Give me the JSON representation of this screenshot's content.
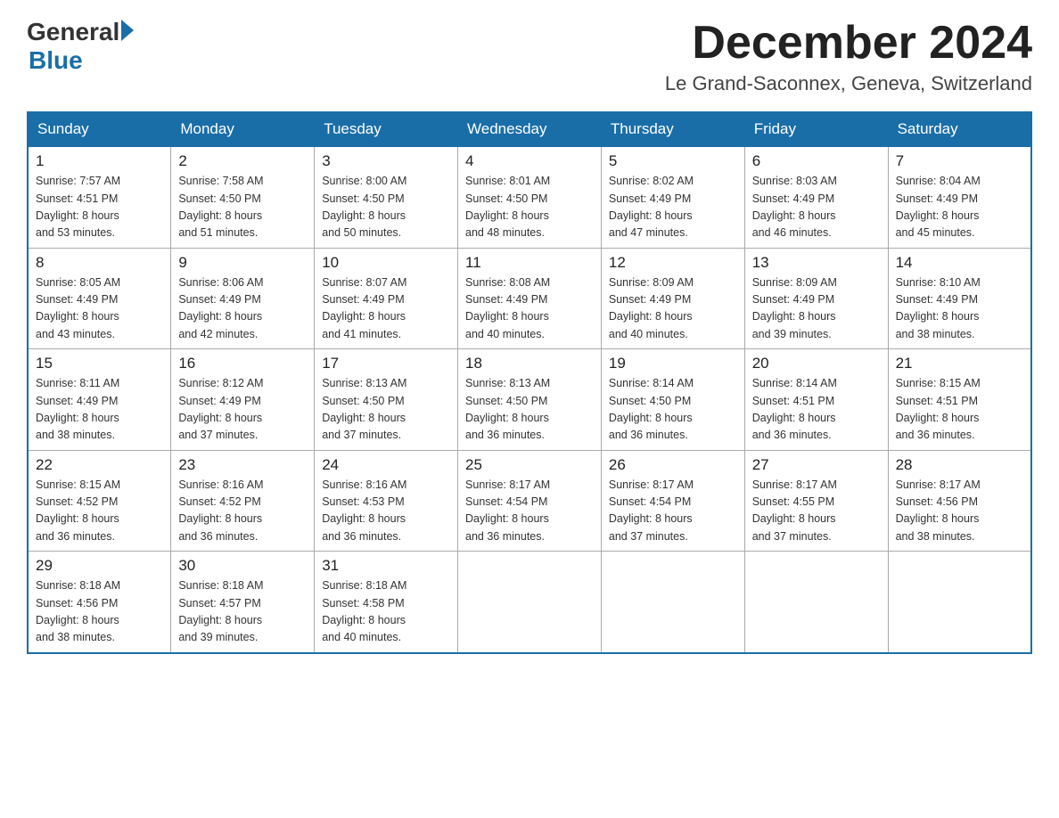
{
  "header": {
    "logo_general": "General",
    "logo_blue": "Blue",
    "month_title": "December 2024",
    "location": "Le Grand-Saconnex, Geneva, Switzerland"
  },
  "days_of_week": [
    "Sunday",
    "Monday",
    "Tuesday",
    "Wednesday",
    "Thursday",
    "Friday",
    "Saturday"
  ],
  "weeks": [
    [
      {
        "day": "1",
        "sunrise": "7:57 AM",
        "sunset": "4:51 PM",
        "daylight": "8 hours and 53 minutes."
      },
      {
        "day": "2",
        "sunrise": "7:58 AM",
        "sunset": "4:50 PM",
        "daylight": "8 hours and 51 minutes."
      },
      {
        "day": "3",
        "sunrise": "8:00 AM",
        "sunset": "4:50 PM",
        "daylight": "8 hours and 50 minutes."
      },
      {
        "day": "4",
        "sunrise": "8:01 AM",
        "sunset": "4:50 PM",
        "daylight": "8 hours and 48 minutes."
      },
      {
        "day": "5",
        "sunrise": "8:02 AM",
        "sunset": "4:49 PM",
        "daylight": "8 hours and 47 minutes."
      },
      {
        "day": "6",
        "sunrise": "8:03 AM",
        "sunset": "4:49 PM",
        "daylight": "8 hours and 46 minutes."
      },
      {
        "day": "7",
        "sunrise": "8:04 AM",
        "sunset": "4:49 PM",
        "daylight": "8 hours and 45 minutes."
      }
    ],
    [
      {
        "day": "8",
        "sunrise": "8:05 AM",
        "sunset": "4:49 PM",
        "daylight": "8 hours and 43 minutes."
      },
      {
        "day": "9",
        "sunrise": "8:06 AM",
        "sunset": "4:49 PM",
        "daylight": "8 hours and 42 minutes."
      },
      {
        "day": "10",
        "sunrise": "8:07 AM",
        "sunset": "4:49 PM",
        "daylight": "8 hours and 41 minutes."
      },
      {
        "day": "11",
        "sunrise": "8:08 AM",
        "sunset": "4:49 PM",
        "daylight": "8 hours and 40 minutes."
      },
      {
        "day": "12",
        "sunrise": "8:09 AM",
        "sunset": "4:49 PM",
        "daylight": "8 hours and 40 minutes."
      },
      {
        "day": "13",
        "sunrise": "8:09 AM",
        "sunset": "4:49 PM",
        "daylight": "8 hours and 39 minutes."
      },
      {
        "day": "14",
        "sunrise": "8:10 AM",
        "sunset": "4:49 PM",
        "daylight": "8 hours and 38 minutes."
      }
    ],
    [
      {
        "day": "15",
        "sunrise": "8:11 AM",
        "sunset": "4:49 PM",
        "daylight": "8 hours and 38 minutes."
      },
      {
        "day": "16",
        "sunrise": "8:12 AM",
        "sunset": "4:49 PM",
        "daylight": "8 hours and 37 minutes."
      },
      {
        "day": "17",
        "sunrise": "8:13 AM",
        "sunset": "4:50 PM",
        "daylight": "8 hours and 37 minutes."
      },
      {
        "day": "18",
        "sunrise": "8:13 AM",
        "sunset": "4:50 PM",
        "daylight": "8 hours and 36 minutes."
      },
      {
        "day": "19",
        "sunrise": "8:14 AM",
        "sunset": "4:50 PM",
        "daylight": "8 hours and 36 minutes."
      },
      {
        "day": "20",
        "sunrise": "8:14 AM",
        "sunset": "4:51 PM",
        "daylight": "8 hours and 36 minutes."
      },
      {
        "day": "21",
        "sunrise": "8:15 AM",
        "sunset": "4:51 PM",
        "daylight": "8 hours and 36 minutes."
      }
    ],
    [
      {
        "day": "22",
        "sunrise": "8:15 AM",
        "sunset": "4:52 PM",
        "daylight": "8 hours and 36 minutes."
      },
      {
        "day": "23",
        "sunrise": "8:16 AM",
        "sunset": "4:52 PM",
        "daylight": "8 hours and 36 minutes."
      },
      {
        "day": "24",
        "sunrise": "8:16 AM",
        "sunset": "4:53 PM",
        "daylight": "8 hours and 36 minutes."
      },
      {
        "day": "25",
        "sunrise": "8:17 AM",
        "sunset": "4:54 PM",
        "daylight": "8 hours and 36 minutes."
      },
      {
        "day": "26",
        "sunrise": "8:17 AM",
        "sunset": "4:54 PM",
        "daylight": "8 hours and 37 minutes."
      },
      {
        "day": "27",
        "sunrise": "8:17 AM",
        "sunset": "4:55 PM",
        "daylight": "8 hours and 37 minutes."
      },
      {
        "day": "28",
        "sunrise": "8:17 AM",
        "sunset": "4:56 PM",
        "daylight": "8 hours and 38 minutes."
      }
    ],
    [
      {
        "day": "29",
        "sunrise": "8:18 AM",
        "sunset": "4:56 PM",
        "daylight": "8 hours and 38 minutes."
      },
      {
        "day": "30",
        "sunrise": "8:18 AM",
        "sunset": "4:57 PM",
        "daylight": "8 hours and 39 minutes."
      },
      {
        "day": "31",
        "sunrise": "8:18 AM",
        "sunset": "4:58 PM",
        "daylight": "8 hours and 40 minutes."
      },
      null,
      null,
      null,
      null
    ]
  ],
  "labels": {
    "sunrise": "Sunrise:",
    "sunset": "Sunset:",
    "daylight": "Daylight:"
  }
}
